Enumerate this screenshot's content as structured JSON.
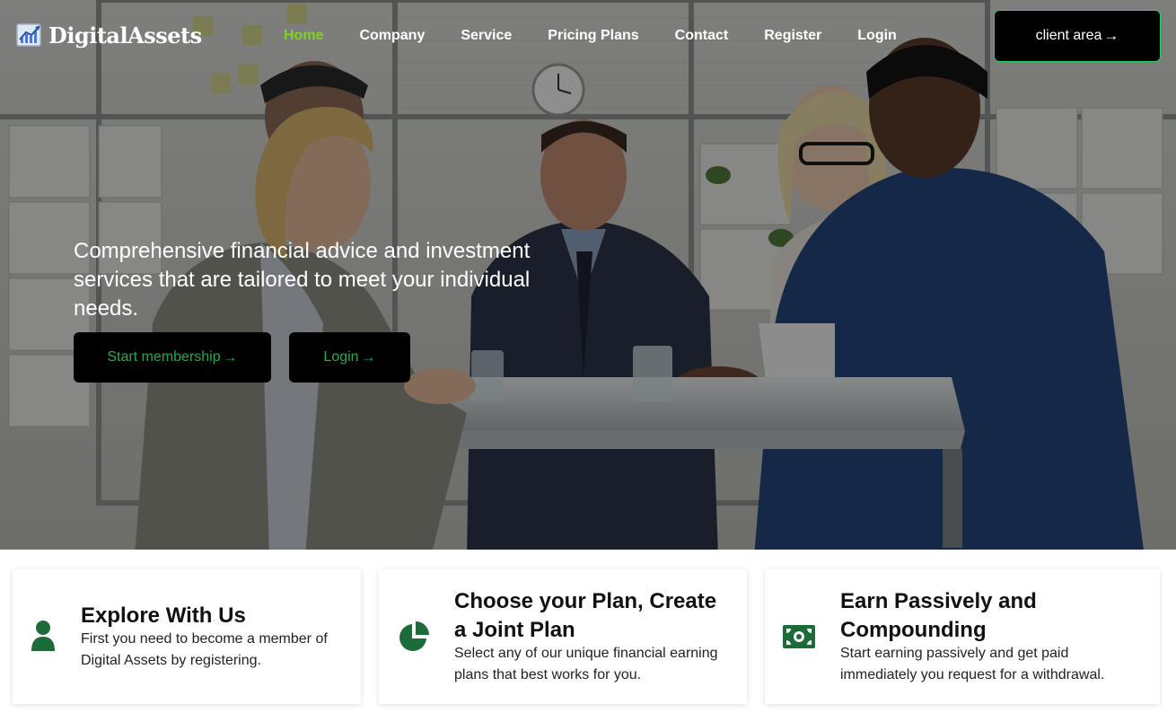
{
  "brand": {
    "name": "DigitalAssets",
    "logo_icon": "chart-logo-icon"
  },
  "nav": {
    "items": [
      {
        "label": "Home",
        "active": true
      },
      {
        "label": "Company",
        "active": false
      },
      {
        "label": "Service",
        "active": false
      },
      {
        "label": "Pricing Plans",
        "active": false
      },
      {
        "label": "Contact",
        "active": false
      },
      {
        "label": "Register",
        "active": false
      },
      {
        "label": "Login",
        "active": false
      }
    ],
    "client_area_label": "client area",
    "arrow_icon": "arrow-right-icon"
  },
  "hero": {
    "headline": "Comprehensive financial advice and investment services that are tailored to meet your individual needs.",
    "primary_button": "Start membership",
    "secondary_button": "Login"
  },
  "features": [
    {
      "icon": "user-icon",
      "title": "Explore With Us",
      "description": "First you need to become a member of Digital Assets by registering."
    },
    {
      "icon": "pie-chart-icon",
      "title": "Choose your Plan, Create a Joint Plan",
      "description": "Select any of our unique financial earning plans that best works for you."
    },
    {
      "icon": "money-bill-icon",
      "title": "Earn Passively and Compounding",
      "description": "Start earning passively and get paid immediately you request for a withdrawal."
    }
  ],
  "colors": {
    "accent_green": "#7ed321",
    "button_text_green": "#2aa84a",
    "icon_green": "#1e6b3a",
    "button_bg": "#000000"
  }
}
